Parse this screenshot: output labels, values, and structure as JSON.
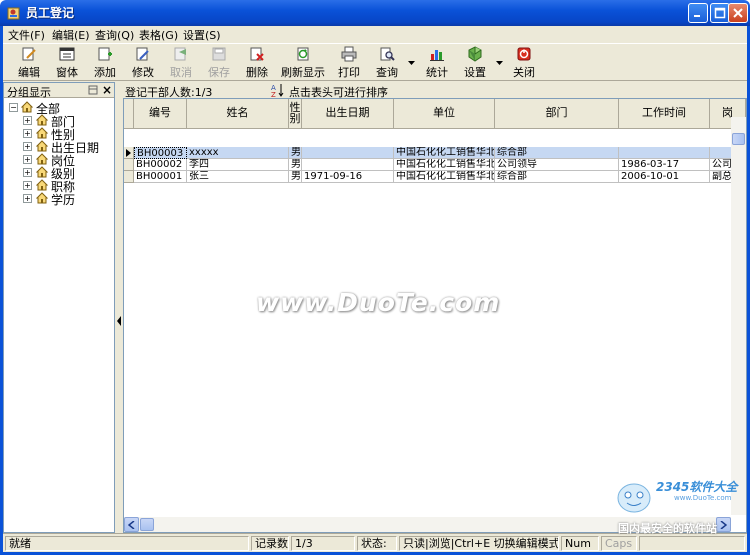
{
  "window": {
    "title": "员工登记"
  },
  "menu": [
    {
      "label": "文件(F)"
    },
    {
      "label": "编辑(E)"
    },
    {
      "label": "查询(Q)"
    },
    {
      "label": "表格(G)"
    },
    {
      "label": "设置(S)"
    }
  ],
  "toolbar": {
    "edit": "编辑",
    "window": "窗体",
    "add": "添加",
    "modify": "修改",
    "cancel": "取消",
    "save": "保存",
    "delete": "删除",
    "refresh": "刷新显示",
    "print": "打印",
    "query": "查询",
    "stats": "统计",
    "settings": "设置",
    "close": "关闭"
  },
  "left_panel": {
    "header": "分组显示",
    "close_glyph": "×",
    "tree": [
      {
        "label": "全部",
        "expander": "−"
      },
      {
        "label": "部门",
        "expander": "+"
      },
      {
        "label": "性别",
        "expander": "+"
      },
      {
        "label": "出生日期",
        "expander": "+"
      },
      {
        "label": "岗位",
        "expander": "+"
      },
      {
        "label": "级别",
        "expander": "+"
      },
      {
        "label": "职称",
        "expander": "+"
      },
      {
        "label": "学历",
        "expander": "+"
      }
    ]
  },
  "info": {
    "count": "登记干部人数:1/3",
    "sort_hint": "点击表头可进行排序"
  },
  "grid": {
    "columns": [
      "编号",
      "姓名",
      "性别",
      "出生日期",
      "单位",
      "部门",
      "工作时间",
      "岗"
    ],
    "rows": [
      [
        "BH00003",
        "xxxxx",
        "男",
        "",
        "中国石化化工销售华北",
        "综合部",
        "",
        ""
      ],
      [
        "BH00002",
        "李四",
        "男",
        "",
        "中国石化化工销售华北",
        "公司领导",
        "1986-03-17",
        "公司领"
      ],
      [
        "BH00001",
        "张三",
        "男",
        "1971-09-16",
        "中国石化化工销售华北",
        "综合部",
        "2006-10-01",
        "副总经"
      ]
    ]
  },
  "watermark": "www.DuoTe.com",
  "status": {
    "ready": "就绪",
    "records_label": "记录数:",
    "records_value": "1/3",
    "state_label": "状态:",
    "state_value": "只读|浏览|Ctrl+E 切换编辑模式",
    "num": "Num",
    "caps": "Caps"
  },
  "corner_logo": {
    "brand": "2345软件大全",
    "site": "www.DuoTe.com",
    "slogan": "国内最安全的软件站"
  },
  "colors": {
    "title_bar": "#0a52d8",
    "selected_row": "#c6d8f2",
    "frame": "#ece9d8"
  }
}
